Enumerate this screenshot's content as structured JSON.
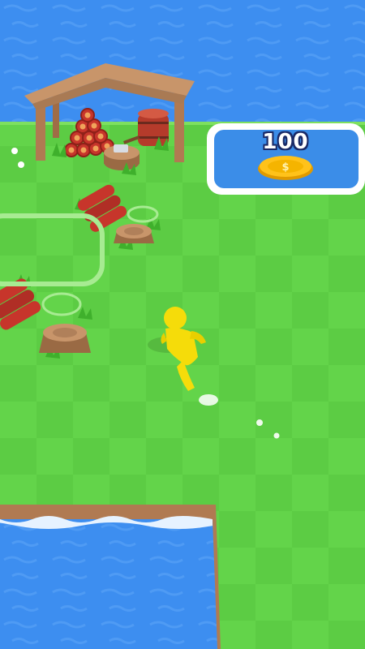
{
  "buy_zone": {
    "price": "100",
    "coin_icon": "dollar-coin-icon"
  },
  "colors": {
    "water": "#3d8ef0",
    "grass_light": "#63d44a",
    "grass_dark": "#57c73f",
    "wood": "#c8956a",
    "log_red": "#c7352b",
    "player": "#f5dc0a",
    "buy_zone_fill": "#3b8de8",
    "coin": "#f5b400"
  }
}
